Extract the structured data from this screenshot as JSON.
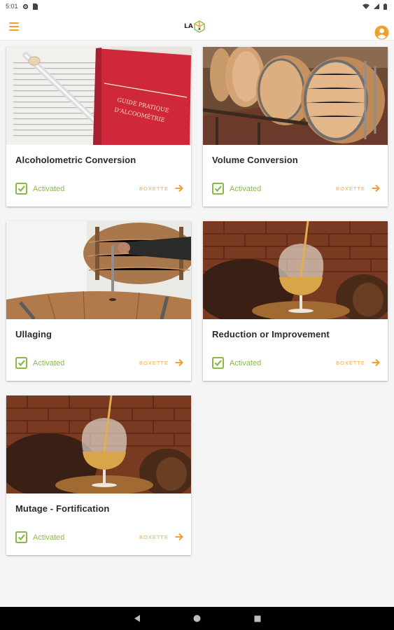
{
  "status_bar": {
    "time": "5:01"
  },
  "app_bar": {
    "logo_text": "LA",
    "menu_icon": "hamburger-menu-icon",
    "profile_icon": "account-circle-icon",
    "accent_color": "#f0a031"
  },
  "cards": [
    {
      "title": "Alcoholometric Conversion",
      "status": "Activated",
      "action": "BOXETTE",
      "image": "alcoholometry-book-and-hydrometer",
      "book_text_1": "GUIDE PRATIQUE",
      "book_text_2": "D'ALCOOMÉTRIE"
    },
    {
      "title": "Volume Conversion",
      "status": "Activated",
      "action": "BOXETTE",
      "image": "oak-barrels-on-rack"
    },
    {
      "title": "Ullaging",
      "status": "Activated",
      "action": "BOXETTE",
      "image": "dipstick-in-barrel"
    },
    {
      "title": "Reduction or Improvement",
      "status": "Activated",
      "action": "BOXETTE",
      "image": "brandy-glass-pour"
    },
    {
      "title": "Mutage - Fortification",
      "status": "Activated",
      "action": "BOXETTE",
      "image": "brandy-glass-pour"
    }
  ],
  "colors": {
    "activated_green": "#8cb84a",
    "action_orange": "#f1a64a",
    "background": "#f5f5f5"
  }
}
